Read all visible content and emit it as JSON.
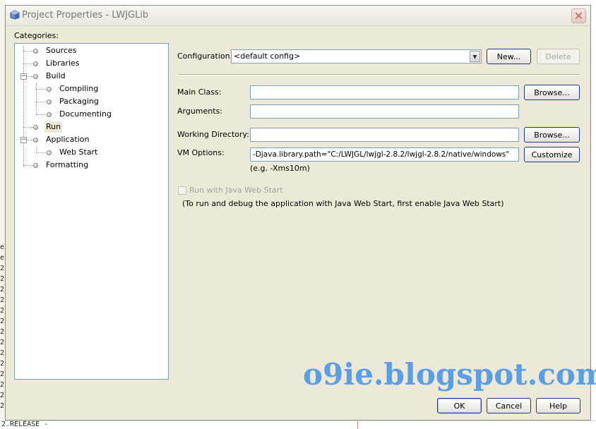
{
  "background": {
    "code_lines": [
      "e",
      "e",
      "2.",
      "2.",
      "2.",
      "2.",
      "2.",
      "2.",
      "2.",
      "2.",
      "2.",
      "2.",
      "2.",
      "2.",
      "2.",
      "2."
    ],
    "bottom_text": "2.RELEASE -"
  },
  "dialog": {
    "title": "Project Properties - LWJGLib",
    "close_label": "✕"
  },
  "categories": {
    "label": "Categories:",
    "items": [
      {
        "label": "Sources"
      },
      {
        "label": "Libraries"
      },
      {
        "label": "Build"
      },
      {
        "label": "Compiling"
      },
      {
        "label": "Packaging"
      },
      {
        "label": "Documenting"
      },
      {
        "label": "Run"
      },
      {
        "label": "Application"
      },
      {
        "label": "Web Start"
      },
      {
        "label": "Formatting"
      }
    ]
  },
  "form": {
    "configuration_label": "Configuration:",
    "configuration_value": "<default config>",
    "new_button": "New...",
    "delete_button": "Delete",
    "main_class_label": "Main Class:",
    "main_class_value": "",
    "browse_button_1": "Browse...",
    "arguments_label": "Arguments:",
    "arguments_value": "",
    "working_dir_label": "Working Directory:",
    "working_dir_value": "",
    "browse_button_2": "Browse...",
    "vm_options_label": "VM Options:",
    "vm_options_value": "-Djava.library.path=\"C:/LWJGL/lwjgl-2.8.2/lwjgl-2.8.2/native/windows\"",
    "customize_button": "Customize",
    "vm_hint": "(e.g. -Xms10m)",
    "web_start_checkbox_label": "Run with Java Web Start",
    "web_start_note": "(To run and debug the application with Java Web Start, first enable Java Web Start)"
  },
  "footer": {
    "ok_button": "OK",
    "cancel_button": "Cancel",
    "help_button": "Help"
  },
  "watermark": "o9ie.blogspot.com"
}
